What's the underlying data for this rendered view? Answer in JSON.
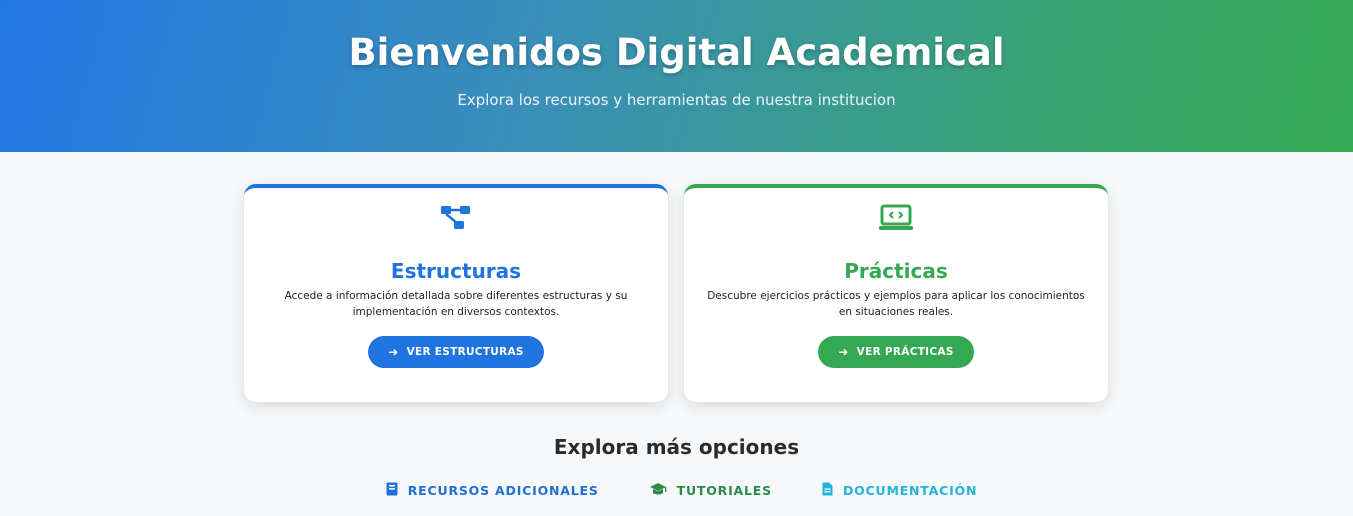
{
  "hero": {
    "title": "Bienvenidos Digital Academical",
    "subtitle": "Explora los recursos y herramientas de nuestra institucion"
  },
  "cards": [
    {
      "icon": "sitemap-icon",
      "title": "Estructuras",
      "description": "Accede a información detallada sobre diferentes estructuras y su implementación en diversos contextos.",
      "button_label": "VER ESTRUCTURAS",
      "accent": "#1f74e0"
    },
    {
      "icon": "laptop-code-icon",
      "title": "Prácticas",
      "description": "Descubre ejercicios prácticos y ejemplos para aplicar los conocimientos en situaciones reales.",
      "button_label": "VER PRÁCTICAS",
      "accent": "#34a853"
    }
  ],
  "more": {
    "heading": "Explora más opciones",
    "links": [
      {
        "icon": "book-icon",
        "label": "RECURSOS ADICIONALES",
        "color": "#1f6fd6"
      },
      {
        "icon": "graduation-cap-icon",
        "label": "TUTORIALES",
        "color": "#2a8a4a"
      },
      {
        "icon": "file-icon",
        "label": "DOCUMENTACIÓN",
        "color": "#22b3d8"
      }
    ]
  }
}
